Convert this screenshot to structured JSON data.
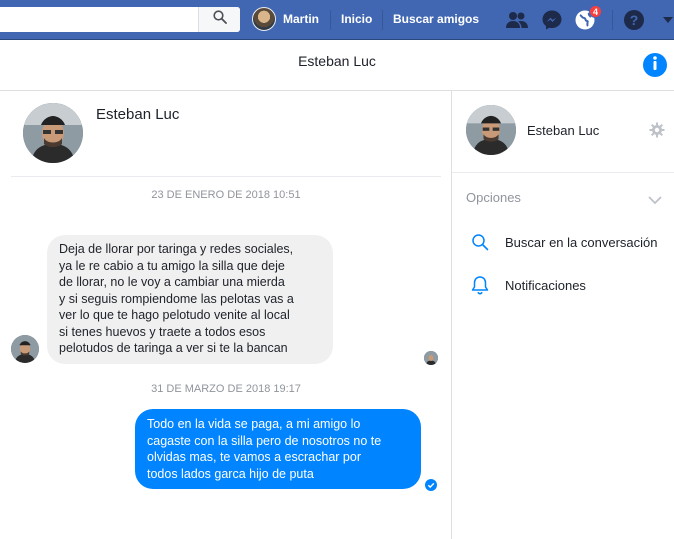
{
  "topbar": {
    "user_name": "Martin",
    "home_label": "Inicio",
    "find_friends_label": "Buscar amigos",
    "notifications_count": "4",
    "brand_color": "#4267b2"
  },
  "conversation": {
    "title": "Esteban Luc",
    "contact_name": "Esteban Luc",
    "accent_color": "#0084ff",
    "messages": [
      {
        "date": "23 DE ENERO DE 2018 10:51",
        "direction": "incoming",
        "lines": [
          "Deja de llorar por taringa y redes sociales,",
          "ya le re cabio a tu amigo la silla que deje",
          "de llorar, no le voy a cambiar una mierda",
          "y si seguis rompiendome las pelotas vas a",
          "ver lo que te hago pelotudo venite al local",
          "si tenes huevos y traete a todos esos",
          "pelotudos de taringa a ver si te la bancan"
        ]
      },
      {
        "date": "31 DE MARZO DE 2018 19:17",
        "direction": "outgoing",
        "lines": [
          "Todo en la vida se paga, a mi amigo lo",
          "cagaste con la silla pero de nosotros no te",
          "olvidas mas, te vamos a escrachar por",
          "todos lados garca hijo de puta"
        ]
      }
    ]
  },
  "sidebar": {
    "contact_name": "Esteban Luc",
    "options_label": "Opciones",
    "search_label": "Buscar en la conversación",
    "notifications_label": "Notificaciones"
  }
}
